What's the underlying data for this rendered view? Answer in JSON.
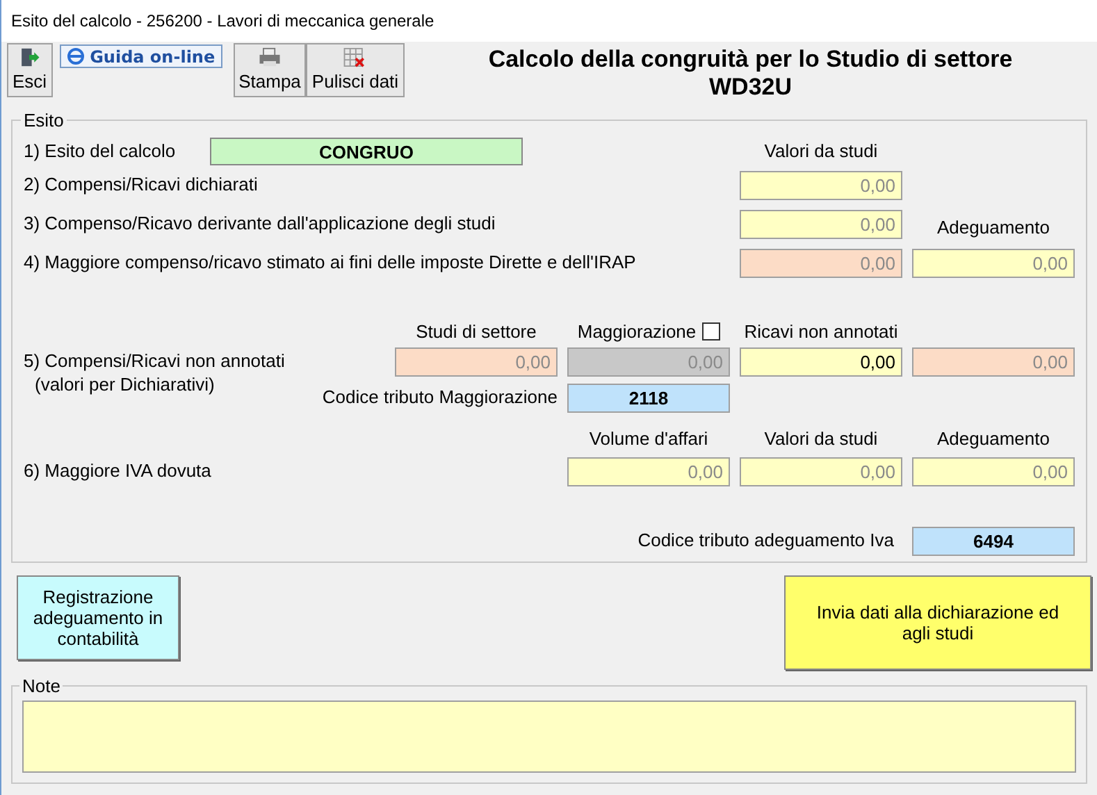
{
  "window": {
    "title": "Esito del calcolo - 256200 - Lavori di meccanica generale"
  },
  "toolbar": [
    {
      "kind": "exit",
      "label": "Esci"
    },
    {
      "kind": "link",
      "label": "Guida on-line"
    },
    {
      "kind": "print",
      "label": "Stampa"
    },
    {
      "kind": "clear",
      "label": "Pulisci dati"
    }
  ],
  "heading": "Calcolo della congruità per lo Studio di settore WD32U",
  "esito": {
    "legend": "Esito",
    "row1": {
      "label": "1) Esito del calcolo",
      "value": "CONGRUO",
      "header": "Valori da studi"
    },
    "row2": {
      "label": "2) Compensi/Ricavi dichiarati",
      "fields": [
        {
          "value": "0,00",
          "color": "#ffffc4",
          "disabled": true
        }
      ]
    },
    "row3": {
      "label": "3) Compenso/Ricavo derivante dall'applicazione degli studi",
      "fields": [
        {
          "value": "0,00",
          "color": "#ffffc4",
          "disabled": true
        }
      ],
      "header": "Adeguamento"
    },
    "row4": {
      "label": "4) Maggiore compenso/ricavo stimato ai fini delle imposte Dirette e dell'IRAP",
      "fields": [
        {
          "value": "0,00",
          "color": "#fcdcc6",
          "disabled": true
        },
        {
          "value": "0,00",
          "color": "#ffffc4",
          "disabled": true
        }
      ]
    },
    "row5": {
      "headers": [
        "Studi di settore",
        "Maggiorazione",
        "Ricavi non annotati"
      ],
      "maggiorazione_checked": false,
      "label": "5) Compensi/Ricavi non annotati",
      "sublabel": "(valori per Dichiarativi)",
      "fields": [
        {
          "value": "0,00",
          "color": "#fcdcc6",
          "disabled": true
        },
        {
          "value": "0,00",
          "color": "#c8c8c8",
          "disabled": true
        },
        {
          "value": "0,00",
          "color": "#ffffc4",
          "disabled": false
        },
        {
          "value": "0,00",
          "color": "#fcdcc6",
          "disabled": true
        }
      ],
      "code_label": "Codice tributo Maggiorazione",
      "code": "2118"
    },
    "row6": {
      "headers": [
        "Volume d'affari",
        "Valori da studi",
        "Adeguamento"
      ],
      "label": "6) Maggiore IVA dovuta",
      "fields": [
        {
          "value": "0,00",
          "color": "#ffffc4",
          "disabled": true
        },
        {
          "value": "0,00",
          "color": "#ffffc4",
          "disabled": true
        },
        {
          "value": "0,00",
          "color": "#ffffc4",
          "disabled": true
        }
      ],
      "code_label": "Codice tributo adeguamento Iva",
      "code": "6494"
    }
  },
  "actions": [
    {
      "label": "Registrazione adeguamento in contabilità",
      "color": "#c8fbfd"
    },
    {
      "label": "Invia dati alla dichiarazione ed agli studi",
      "color": "#ffff6b"
    }
  ],
  "note": {
    "legend": "Note"
  }
}
